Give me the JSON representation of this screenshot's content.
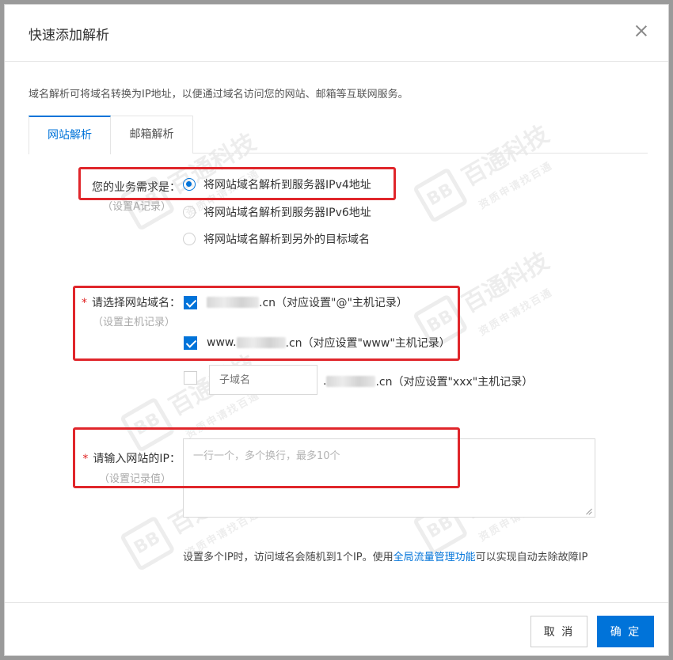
{
  "dialog": {
    "title": "快速添加解析",
    "intro": "域名解析可将域名转换为IP地址，以便通过域名访问您的网站、邮箱等互联网服务。",
    "tabs": [
      {
        "label": "网站解析",
        "active": true
      },
      {
        "label": "邮箱解析",
        "active": false
      }
    ]
  },
  "need": {
    "label": "您的业务需求是：",
    "sublabel": "（设置A记录）",
    "options": [
      {
        "label": "将网站域名解析到服务器IPv4地址",
        "selected": true
      },
      {
        "label": "将网站域名解析到服务器IPv6地址",
        "selected": false
      },
      {
        "label": "将网站域名解析到另外的目标域名",
        "selected": false
      }
    ]
  },
  "domain": {
    "required_mark": "*",
    "label": "请选择网站域名：",
    "sublabel": "（设置主机记录）",
    "options": [
      {
        "prefix": "",
        "suffix": ".cn（对应设置\"@\"主机记录）",
        "checked": true
      },
      {
        "prefix": "www.",
        "suffix": ".cn（对应设置\"www\"主机记录）",
        "checked": true
      }
    ],
    "subdomain": {
      "placeholder": "子域名",
      "suffix": ".cn（对应设置\"xxx\"主机记录）",
      "prefix_dot": ".",
      "checked": false
    }
  },
  "ip": {
    "required_mark": "*",
    "label": "请输入网站的IP：",
    "sublabel": "（设置记录值）",
    "placeholder": "一行一个，多个换行，最多10个"
  },
  "hint": {
    "text_before": "设置多个IP时，访问域名会随机到1个IP。使用",
    "link": "全局流量管理功能",
    "text_after": "可以实现自动去除故障IP"
  },
  "footer": {
    "cancel": "取 消",
    "ok": "确 定"
  },
  "watermark": {
    "logo": "BB",
    "name": "百通科技",
    "tagline": "资质申请找百通"
  },
  "colors": {
    "accent": "#0073d9",
    "highlight_box": "#e0262b",
    "required": "#e02020"
  }
}
